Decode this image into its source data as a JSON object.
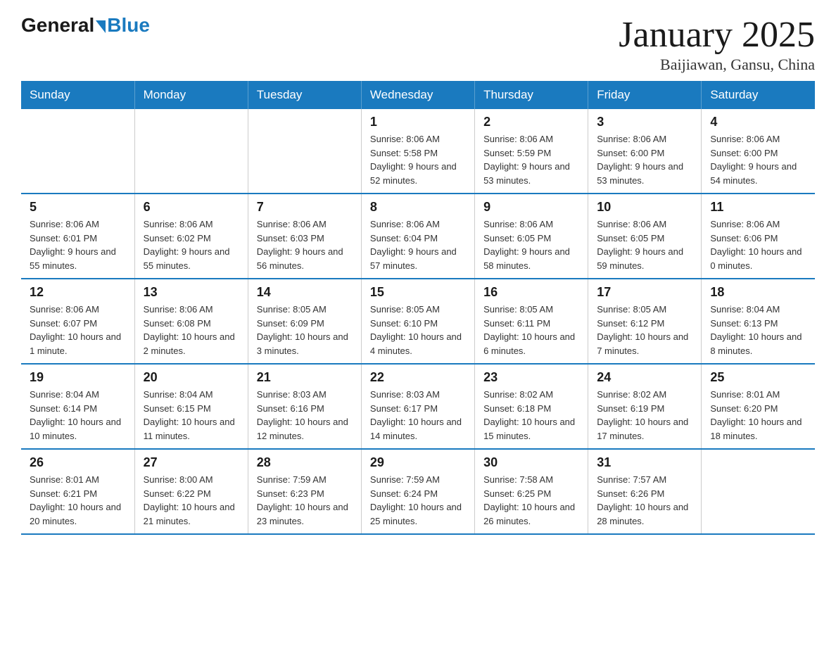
{
  "logo": {
    "general": "General",
    "blue": "Blue"
  },
  "header": {
    "title": "January 2025",
    "subtitle": "Baijiawan, Gansu, China"
  },
  "days_of_week": [
    "Sunday",
    "Monday",
    "Tuesday",
    "Wednesday",
    "Thursday",
    "Friday",
    "Saturday"
  ],
  "weeks": [
    [
      {
        "day": "",
        "info": ""
      },
      {
        "day": "",
        "info": ""
      },
      {
        "day": "",
        "info": ""
      },
      {
        "day": "1",
        "info": "Sunrise: 8:06 AM\nSunset: 5:58 PM\nDaylight: 9 hours\nand 52 minutes."
      },
      {
        "day": "2",
        "info": "Sunrise: 8:06 AM\nSunset: 5:59 PM\nDaylight: 9 hours\nand 53 minutes."
      },
      {
        "day": "3",
        "info": "Sunrise: 8:06 AM\nSunset: 6:00 PM\nDaylight: 9 hours\nand 53 minutes."
      },
      {
        "day": "4",
        "info": "Sunrise: 8:06 AM\nSunset: 6:00 PM\nDaylight: 9 hours\nand 54 minutes."
      }
    ],
    [
      {
        "day": "5",
        "info": "Sunrise: 8:06 AM\nSunset: 6:01 PM\nDaylight: 9 hours\nand 55 minutes."
      },
      {
        "day": "6",
        "info": "Sunrise: 8:06 AM\nSunset: 6:02 PM\nDaylight: 9 hours\nand 55 minutes."
      },
      {
        "day": "7",
        "info": "Sunrise: 8:06 AM\nSunset: 6:03 PM\nDaylight: 9 hours\nand 56 minutes."
      },
      {
        "day": "8",
        "info": "Sunrise: 8:06 AM\nSunset: 6:04 PM\nDaylight: 9 hours\nand 57 minutes."
      },
      {
        "day": "9",
        "info": "Sunrise: 8:06 AM\nSunset: 6:05 PM\nDaylight: 9 hours\nand 58 minutes."
      },
      {
        "day": "10",
        "info": "Sunrise: 8:06 AM\nSunset: 6:05 PM\nDaylight: 9 hours\nand 59 minutes."
      },
      {
        "day": "11",
        "info": "Sunrise: 8:06 AM\nSunset: 6:06 PM\nDaylight: 10 hours\nand 0 minutes."
      }
    ],
    [
      {
        "day": "12",
        "info": "Sunrise: 8:06 AM\nSunset: 6:07 PM\nDaylight: 10 hours\nand 1 minute."
      },
      {
        "day": "13",
        "info": "Sunrise: 8:06 AM\nSunset: 6:08 PM\nDaylight: 10 hours\nand 2 minutes."
      },
      {
        "day": "14",
        "info": "Sunrise: 8:05 AM\nSunset: 6:09 PM\nDaylight: 10 hours\nand 3 minutes."
      },
      {
        "day": "15",
        "info": "Sunrise: 8:05 AM\nSunset: 6:10 PM\nDaylight: 10 hours\nand 4 minutes."
      },
      {
        "day": "16",
        "info": "Sunrise: 8:05 AM\nSunset: 6:11 PM\nDaylight: 10 hours\nand 6 minutes."
      },
      {
        "day": "17",
        "info": "Sunrise: 8:05 AM\nSunset: 6:12 PM\nDaylight: 10 hours\nand 7 minutes."
      },
      {
        "day": "18",
        "info": "Sunrise: 8:04 AM\nSunset: 6:13 PM\nDaylight: 10 hours\nand 8 minutes."
      }
    ],
    [
      {
        "day": "19",
        "info": "Sunrise: 8:04 AM\nSunset: 6:14 PM\nDaylight: 10 hours\nand 10 minutes."
      },
      {
        "day": "20",
        "info": "Sunrise: 8:04 AM\nSunset: 6:15 PM\nDaylight: 10 hours\nand 11 minutes."
      },
      {
        "day": "21",
        "info": "Sunrise: 8:03 AM\nSunset: 6:16 PM\nDaylight: 10 hours\nand 12 minutes."
      },
      {
        "day": "22",
        "info": "Sunrise: 8:03 AM\nSunset: 6:17 PM\nDaylight: 10 hours\nand 14 minutes."
      },
      {
        "day": "23",
        "info": "Sunrise: 8:02 AM\nSunset: 6:18 PM\nDaylight: 10 hours\nand 15 minutes."
      },
      {
        "day": "24",
        "info": "Sunrise: 8:02 AM\nSunset: 6:19 PM\nDaylight: 10 hours\nand 17 minutes."
      },
      {
        "day": "25",
        "info": "Sunrise: 8:01 AM\nSunset: 6:20 PM\nDaylight: 10 hours\nand 18 minutes."
      }
    ],
    [
      {
        "day": "26",
        "info": "Sunrise: 8:01 AM\nSunset: 6:21 PM\nDaylight: 10 hours\nand 20 minutes."
      },
      {
        "day": "27",
        "info": "Sunrise: 8:00 AM\nSunset: 6:22 PM\nDaylight: 10 hours\nand 21 minutes."
      },
      {
        "day": "28",
        "info": "Sunrise: 7:59 AM\nSunset: 6:23 PM\nDaylight: 10 hours\nand 23 minutes."
      },
      {
        "day": "29",
        "info": "Sunrise: 7:59 AM\nSunset: 6:24 PM\nDaylight: 10 hours\nand 25 minutes."
      },
      {
        "day": "30",
        "info": "Sunrise: 7:58 AM\nSunset: 6:25 PM\nDaylight: 10 hours\nand 26 minutes."
      },
      {
        "day": "31",
        "info": "Sunrise: 7:57 AM\nSunset: 6:26 PM\nDaylight: 10 hours\nand 28 minutes."
      },
      {
        "day": "",
        "info": ""
      }
    ]
  ]
}
